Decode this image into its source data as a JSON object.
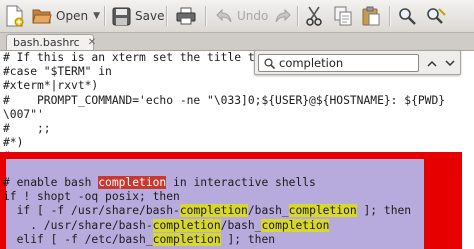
{
  "toolbar": {
    "open_label": "Open",
    "save_label": "Save",
    "undo_label": "Undo"
  },
  "tab": {
    "title": "bash.bashrc",
    "close_glyph": "✕"
  },
  "search": {
    "value": "completion",
    "up_glyph": "⌃",
    "down_glyph": "⌄"
  },
  "editor": {
    "top_lines": [
      "# If this is an xterm set the title to",
      "#case \"$TERM\" in",
      "#xterm*|rxvt*)",
      "#    PROMPT_COMMAND='echo -ne \"\\033]0;${USER}@${HOSTNAME}: ${PWD}",
      "\\007\"'",
      "#    ;;",
      "#*)",
      "#    ;;"
    ],
    "sel_lines": [
      [
        "# enable bash ",
        "completion",
        " in interactive shells"
      ],
      [
        "if ! shopt -oq posix; then"
      ],
      [
        "  if [ -f /usr/share/bash-",
        "completion",
        "/bash_",
        "completion",
        " ]; then"
      ],
      [
        "    . /usr/share/bash-",
        "completion",
        "/bash_",
        "completion"
      ],
      [
        "  elif [ -f /etc/bash_",
        "completion",
        " ]; then"
      ]
    ]
  },
  "colors": {
    "selection": "#b7aadd",
    "match_highlight": "#d8d72c",
    "current_match": "#c8382e",
    "annotation_frame": "#e60000"
  }
}
